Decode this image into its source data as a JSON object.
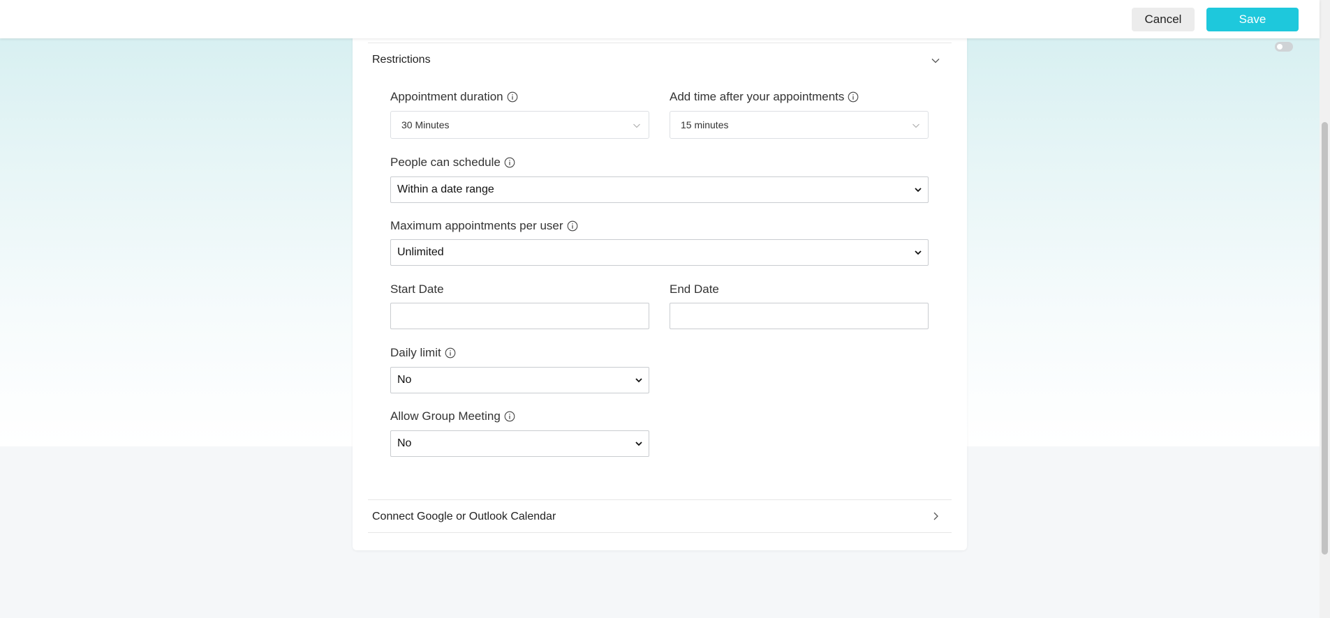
{
  "header": {
    "cancel_label": "Cancel",
    "save_label": "Save"
  },
  "colors": {
    "accent": "#1ec8dc",
    "cancel_bg": "#ececec"
  },
  "restrictions": {
    "title": "Restrictions",
    "appointment_duration": {
      "label": "Appointment duration",
      "value": "30 Minutes"
    },
    "add_time_after": {
      "label": "Add time after your appointments",
      "value": "15 minutes"
    },
    "people_can_schedule": {
      "label": "People can schedule",
      "value": "Within a date range"
    },
    "max_appointments": {
      "label": "Maximum appointments per user",
      "value": "Unlimited"
    },
    "start_date": {
      "label": "Start Date",
      "value": ""
    },
    "end_date": {
      "label": "End Date",
      "value": ""
    },
    "daily_limit": {
      "label": "Daily limit",
      "value": "No"
    },
    "allow_group_meeting": {
      "label": "Allow Group Meeting",
      "value": "No"
    }
  },
  "calendar_section": {
    "title": "Connect Google or Outlook Calendar"
  },
  "icons": {
    "info": "info-icon",
    "collapse": "chevron-down-icon",
    "expand": "chevron-right-icon"
  }
}
